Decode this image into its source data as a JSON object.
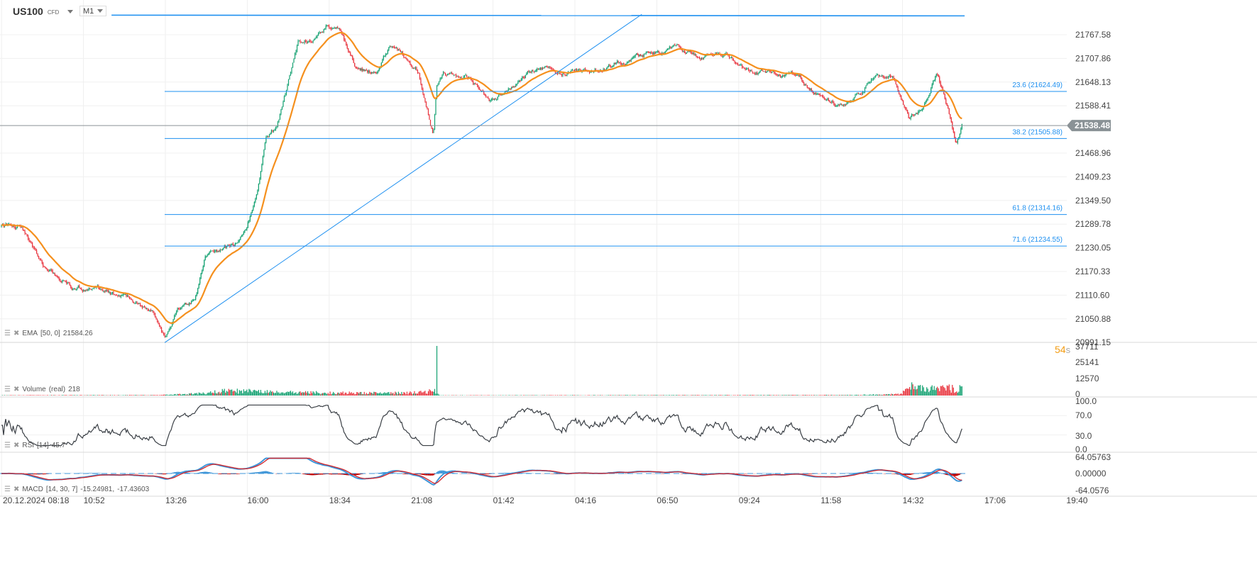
{
  "header": {
    "symbol": "US100",
    "type": "CFD",
    "timeframe": "M1"
  },
  "countdown": {
    "value": "54",
    "unit": "s"
  },
  "legends": {
    "ema": {
      "name": "EMA",
      "params": "[50, 0]",
      "value": "21584.26"
    },
    "volume": {
      "name": "Volume",
      "params": "(real)",
      "value": "218"
    },
    "rsi": {
      "name": "RSI",
      "params": "[14]",
      "value": "45.7"
    },
    "macd": {
      "name": "MACD",
      "params": "[14, 30, 7]",
      "value": "-15.24981,",
      "value2": "-17.43603"
    }
  },
  "colors": {
    "up": "#12a070",
    "down": "#e8323c",
    "ema": "#f5901e",
    "drawing": "#1e90f0",
    "rsi": "#3a3f45",
    "macd": "#3d95d8",
    "signal": "#d3262c",
    "price_tag": "#8a9296"
  },
  "chart_data": {
    "type": "candlestick",
    "title": "US100 CFD M1",
    "price_axis": {
      "min": 20991.15,
      "max": 21767.58,
      "ticks": [
        "21767.58",
        "21707.86",
        "21648.13",
        "21588.41",
        "21468.96",
        "21409.23",
        "21349.50",
        "21289.78",
        "21230.05",
        "21170.33",
        "21110.60",
        "21050.88",
        "20991.15"
      ]
    },
    "time_axis": {
      "ticks": [
        "20.12.2024  08:18",
        "10:52",
        "13:26",
        "16:00",
        "18:34",
        "21:08",
        "01:42",
        "04:16",
        "06:50",
        "09:24",
        "11:58",
        "14:32",
        "17:06",
        "19:40"
      ]
    },
    "current_price": "21538.48",
    "close_path_minutes_price": [
      [
        0,
        21283
      ],
      [
        37,
        21283
      ],
      [
        84,
        21176
      ],
      [
        131,
        21131
      ],
      [
        184,
        21122
      ],
      [
        238,
        21104
      ],
      [
        284,
        21068
      ],
      [
        307,
        20995
      ],
      [
        331,
        21068
      ],
      [
        364,
        21095
      ],
      [
        384,
        21211
      ],
      [
        438,
        21238
      ],
      [
        458,
        21265
      ],
      [
        478,
        21355
      ],
      [
        498,
        21506
      ],
      [
        518,
        21533
      ],
      [
        538,
        21640
      ],
      [
        558,
        21748
      ],
      [
        585,
        21757
      ],
      [
        611,
        21793
      ],
      [
        638,
        21775
      ],
      [
        665,
        21694
      ],
      [
        705,
        21667
      ],
      [
        731,
        21739
      ],
      [
        758,
        21712
      ],
      [
        785,
        21676
      ],
      [
        798,
        21587
      ],
      [
        812,
        21515
      ],
      [
        818,
        21640
      ],
      [
        831,
        21667
      ],
      [
        878,
        21658
      ],
      [
        918,
        21605
      ],
      [
        958,
        21632
      ],
      [
        998,
        21680
      ],
      [
        1052,
        21676
      ],
      [
        1105,
        21676
      ],
      [
        1158,
        21694
      ],
      [
        1212,
        21721
      ],
      [
        1265,
        21730
      ],
      [
        1318,
        21712
      ],
      [
        1359,
        21721
      ],
      [
        1399,
        21676
      ],
      [
        1452,
        21676
      ],
      [
        1492,
        21667
      ],
      [
        1532,
        21623
      ],
      [
        1572,
        21587
      ],
      [
        1599,
        21605
      ],
      [
        1639,
        21658
      ],
      [
        1679,
        21658
      ],
      [
        1706,
        21560
      ],
      [
        1732,
        21587
      ],
      [
        1759,
        21667
      ],
      [
        1779,
        21587
      ],
      [
        1795,
        21489
      ],
      [
        1806,
        21542
      ]
    ],
    "fibonacci": [
      {
        "label": "23.6 (21624.49)",
        "price": 21624.49
      },
      {
        "label": "38.2 (21505.88)",
        "price": 21505.88
      },
      {
        "label": "61.8 (21314.16)",
        "price": 21314.16
      },
      {
        "label": "71.6 (21234.55)",
        "price": 21234.55
      }
    ],
    "drawings": {
      "horizontal_top": {
        "from_minute": 207,
        "to_minute": 1811,
        "price": 21817
      },
      "trendline": {
        "from_minute": 307,
        "from_price": 20991,
        "to_minute": 1204,
        "to_price": 21819
      }
    },
    "volume": {
      "ticks": [
        "37711",
        "25141",
        "12570",
        "0"
      ],
      "max": 37711,
      "envelope_minutes_volume": [
        [
          0,
          300
        ],
        [
          300,
          450
        ],
        [
          380,
          2200
        ],
        [
          430,
          5000
        ],
        [
          500,
          3600
        ],
        [
          560,
          3000
        ],
        [
          700,
          2400
        ],
        [
          800,
          3200
        ],
        [
          812,
          6000
        ],
        [
          825,
          250
        ],
        [
          1600,
          500
        ],
        [
          1690,
          1400
        ],
        [
          1712,
          9000
        ],
        [
          1806,
          6500
        ]
      ],
      "spike": {
        "minute": 818,
        "volume": 37711
      }
    },
    "rsi": {
      "ticks": [
        "100.0",
        "70.0",
        "30.0",
        "0.0"
      ],
      "min": 0,
      "max": 100
    },
    "macd": {
      "ticks": [
        "64.05763",
        "0.00000",
        "-64.0576"
      ],
      "min": -64.0576,
      "max": 64.05763
    }
  }
}
